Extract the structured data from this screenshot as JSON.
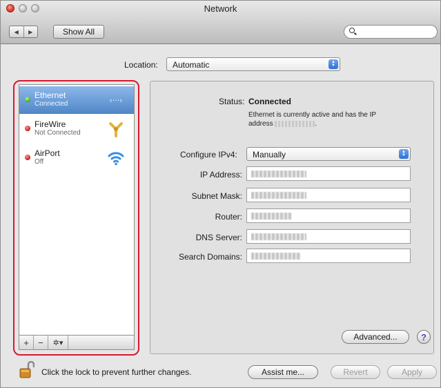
{
  "window": {
    "title": "Network"
  },
  "toolbar": {
    "back": "◀",
    "forward": "▶",
    "show_all": "Show All",
    "search_placeholder": ""
  },
  "location": {
    "label": "Location:",
    "value": "Automatic"
  },
  "services": [
    {
      "name": "Ethernet",
      "status": "Connected",
      "dot": "green",
      "icon": "ethernet-arrows-icon",
      "selected": true
    },
    {
      "name": "FireWire",
      "status": "Not Connected",
      "dot": "red",
      "icon": "firewire-icon",
      "selected": false
    },
    {
      "name": "AirPort",
      "status": "Off",
      "dot": "red",
      "icon": "wifi-icon",
      "selected": false
    }
  ],
  "sidebar_tools": {
    "add": "+",
    "remove": "−",
    "action": "✲▾"
  },
  "detail": {
    "status_label": "Status:",
    "status_value": "Connected",
    "status_desc_1": "Ethernet is currently active and has the IP",
    "status_desc_2": "address",
    "status_desc_3": ".",
    "configure_label": "Configure IPv4:",
    "configure_value": "Manually",
    "ip_label": "IP Address:",
    "subnet_label": "Subnet Mask:",
    "router_label": "Router:",
    "dns_label": "DNS Server:",
    "search_domains_label": "Search Domains:"
  },
  "buttons": {
    "advanced": "Advanced...",
    "help": "?",
    "assist": "Assist me...",
    "revert": "Revert",
    "apply": "Apply"
  },
  "footer": {
    "lock_text": "Click the lock to prevent further changes."
  },
  "colors": {
    "selection": "#4f86c6",
    "highlight_outline": "#d6182e",
    "connected_dot": "#3fa81d",
    "disconnected_dot": "#c8151b"
  }
}
